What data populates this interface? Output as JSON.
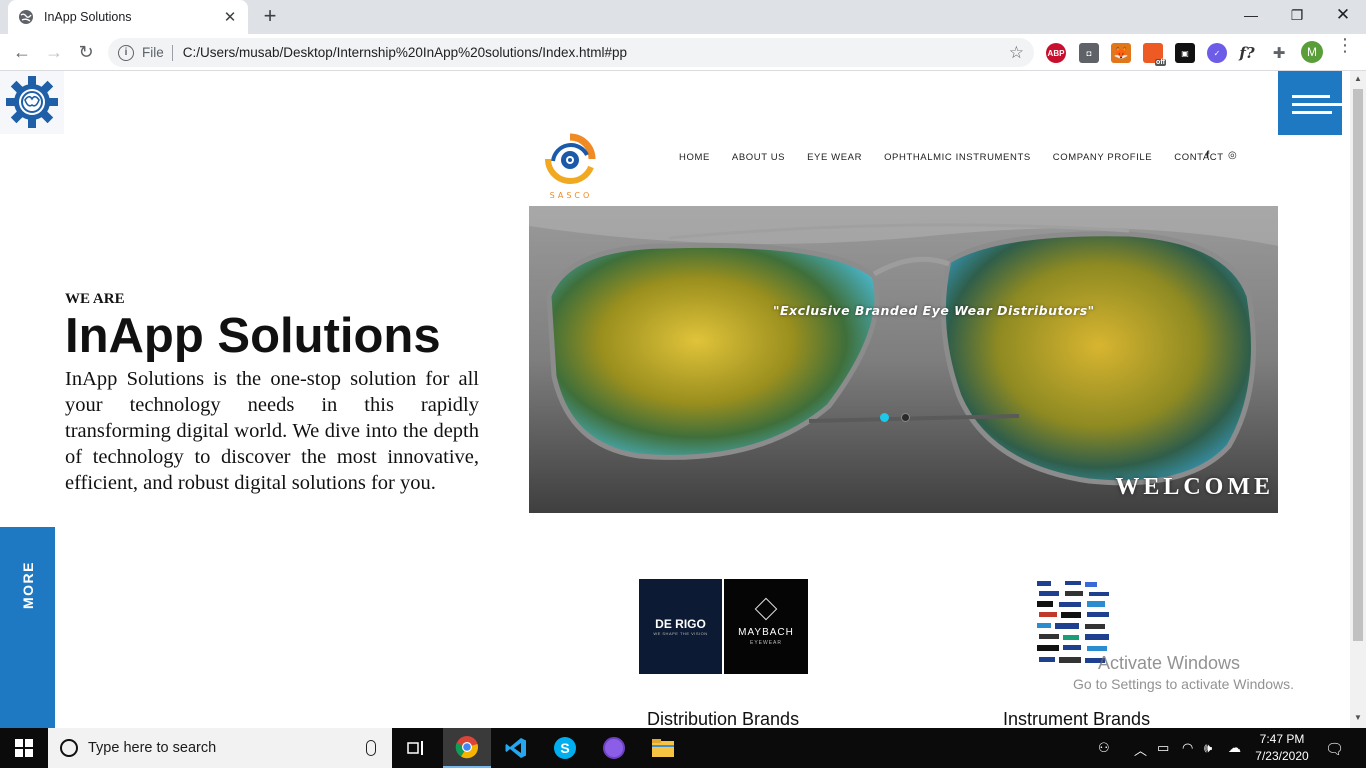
{
  "browser": {
    "tab_title": "InApp Solutions",
    "scheme_label": "File",
    "url": "C:/Users/musab/Desktop/Internship%20InApp%20solutions/Index.html#pp",
    "profile_initial": "M",
    "extensions": [
      "ABP",
      "off",
      "f?"
    ]
  },
  "page": {
    "we_are": "WE ARE",
    "title": "InApp Solutions",
    "description": "InApp Solutions is the one-stop solution for all your technology needs in this rapidly transforming digital world. We dive into the depth of technology to discover the most innovative, efficient, and robust digital solutions for you.",
    "more_label": "MORE",
    "accent_color": "#1e78c2"
  },
  "embedded_site": {
    "logo_text": "SASCO",
    "nav": [
      "HOME",
      "ABOUT US",
      "EYE WEAR",
      "OPHTHALMIC INSTRUMENTS",
      "COMPANY PROFILE",
      "CONTACT"
    ],
    "social_icons": [
      "facebook-icon",
      "instagram-icon"
    ],
    "hero_tagline": "\"Exclusive Branded Eye Wear Distributors\"",
    "hero_heading": "WELCOME",
    "slider_active_index": 0,
    "slider_count": 2,
    "brands": [
      {
        "caption": "Distribution Brands",
        "logos": [
          "DE RIGO",
          "WE SHAPE THE VISION",
          "MAYBACH",
          "EYEWEAR"
        ]
      },
      {
        "caption": "Instrument Brands"
      }
    ]
  },
  "os": {
    "watermark_title": "Activate Windows",
    "watermark_sub": "Go to Settings to activate Windows.",
    "search_placeholder": "Type here to search",
    "time": "7:47 PM",
    "date": "7/23/2020"
  }
}
